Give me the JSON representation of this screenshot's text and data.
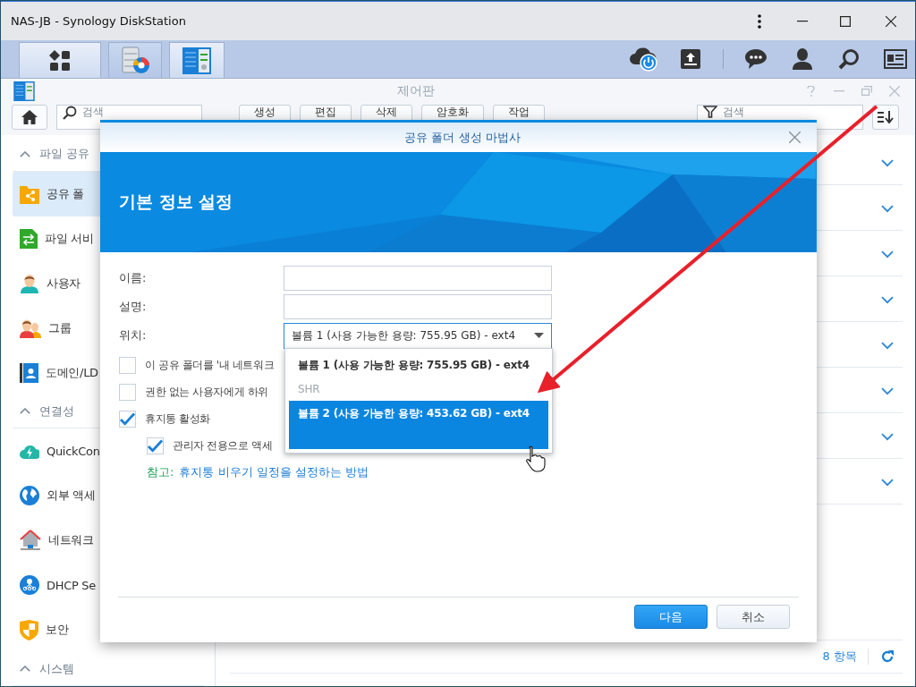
{
  "window": {
    "title": "NAS-JB - Synology DiskStation"
  },
  "control_panel": {
    "title": "제어판",
    "search": {
      "placeholder": "검색"
    },
    "toolbar": [
      "생성",
      "편집",
      "삭제",
      "암호화",
      "작업"
    ],
    "filter": {
      "placeholder": "검색"
    },
    "sidebar": [
      {
        "heading": "파일 공유",
        "expanded": true,
        "items": [
          {
            "label": "공유 폴",
            "selected": true
          },
          {
            "label": "파일 서비",
            "selected": false
          },
          {
            "label": "사용자",
            "selected": false
          },
          {
            "label": "그룹",
            "selected": false
          },
          {
            "label": "도메인/LD",
            "selected": false
          }
        ]
      },
      {
        "heading": "연결성",
        "expanded": true,
        "items": [
          {
            "label": "QuickCon",
            "selected": false
          },
          {
            "label": "외부 액세",
            "selected": false
          },
          {
            "label": "네트워크",
            "selected": false
          },
          {
            "label": "DHCP Se",
            "selected": false
          },
          {
            "label": "보안",
            "selected": false
          }
        ]
      },
      {
        "heading": "시스템",
        "expanded": true
      }
    ],
    "rows": [
      {
        "expanded": false
      },
      {
        "expanded": false
      },
      {
        "expanded": false
      },
      {
        "expanded": false
      },
      {
        "expanded": false
      },
      {
        "expanded": false
      },
      {
        "expanded": false
      },
      {
        "expanded": false
      }
    ],
    "item_count": "8 항목"
  },
  "wizard": {
    "title": "공유 폴더 생성 마법사",
    "heading": "기본 정보 설정",
    "fields": [
      {
        "label": "이름:",
        "kind": "text"
      },
      {
        "label": "설명:",
        "kind": "text"
      },
      {
        "label": "위치:",
        "kind": "select",
        "value": "볼륨 1 (사용 가능한 용량:  755.95 GB) - ext4",
        "open": true
      }
    ],
    "options": [
      {
        "kind": "option",
        "label": "볼륨 1 (사용 가능한 용량: 755.95 GB) - ext4",
        "selected": false
      },
      {
        "kind": "group",
        "label": "SHR"
      },
      {
        "kind": "option",
        "label": "볼륨 2 (사용 가능한 용량: 453.62 GB) - ext4",
        "selected": true
      }
    ],
    "checkboxes": [
      {
        "label": "이 공유 폴더를 '내 네트워크",
        "checked": false
      },
      {
        "label": "권한 없는 사용자에게 하위",
        "checked": false
      },
      {
        "label": "휴지통 활성화",
        "checked": true,
        "children": [
          {
            "label": "관리자 전용으로 액세",
            "checked": true
          }
        ]
      }
    ],
    "note": {
      "prefix": "참고:",
      "link": "휴지통 비우기 일정을 설정하는 방법"
    },
    "buttons": [
      {
        "label": "다음",
        "kind": "primary"
      },
      {
        "label": "취소",
        "kind": "secondary"
      }
    ]
  }
}
